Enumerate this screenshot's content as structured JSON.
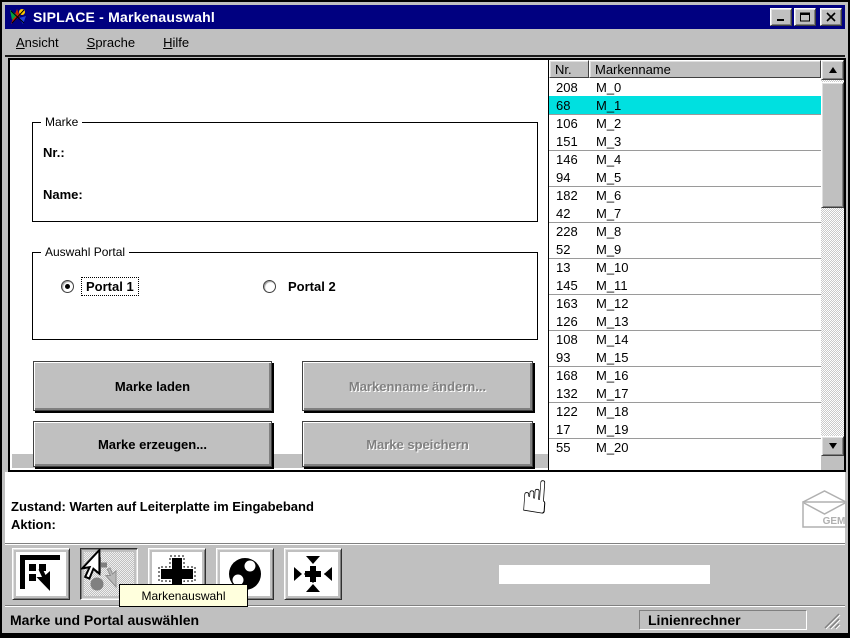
{
  "window": {
    "title": "SIPLACE - Markenauswahl"
  },
  "menu": {
    "items": [
      "Ansicht",
      "Sprache",
      "Hilfe"
    ]
  },
  "marke_group": {
    "title": "Marke",
    "nr_label": "Nr.:",
    "nr_value": "",
    "name_label": "Name:",
    "name_value": ""
  },
  "portal_group": {
    "title": "Auswahl Portal",
    "options": [
      {
        "label": "Portal 1",
        "selected": true
      },
      {
        "label": "Portal 2",
        "selected": false
      }
    ]
  },
  "actions": {
    "load": "Marke laden",
    "rename": "Markenname ändern...",
    "create": "Marke erzeugen...",
    "save": "Marke speichern"
  },
  "list": {
    "columns": [
      "Nr.",
      "Markenname"
    ],
    "selected_index": 1,
    "rows": [
      [
        "208",
        "M_0"
      ],
      [
        "68",
        "M_1"
      ],
      [
        "106",
        "M_2"
      ],
      [
        "151",
        "M_3"
      ],
      [
        "146",
        "M_4"
      ],
      [
        "94",
        "M_5"
      ],
      [
        "182",
        "M_6"
      ],
      [
        "42",
        "M_7"
      ],
      [
        "228",
        "M_8"
      ],
      [
        "52",
        "M_9"
      ],
      [
        "13",
        "M_10"
      ],
      [
        "145",
        "M_11"
      ],
      [
        "163",
        "M_12"
      ],
      [
        "126",
        "M_13"
      ],
      [
        "108",
        "M_14"
      ],
      [
        "93",
        "M_15"
      ],
      [
        "168",
        "M_16"
      ],
      [
        "132",
        "M_17"
      ],
      [
        "122",
        "M_18"
      ],
      [
        "17",
        "M_19"
      ],
      [
        "55",
        "M_20"
      ]
    ]
  },
  "status": {
    "zustand": "Zustand: Warten auf Leiterplatte im Eingabeband",
    "aktion": "Aktion:"
  },
  "toolbar": {
    "tooltip": "Markenauswahl"
  },
  "statusbar": {
    "message": "Marke und Portal auswählen",
    "computer": "Linienrechner"
  },
  "gem": {
    "label": "GEM"
  },
  "colors": {
    "titlebar": "#000080",
    "selection": "#00e0e0",
    "tooltip_bg": "#ffffdd",
    "window_gray": "#c0c0c0"
  }
}
